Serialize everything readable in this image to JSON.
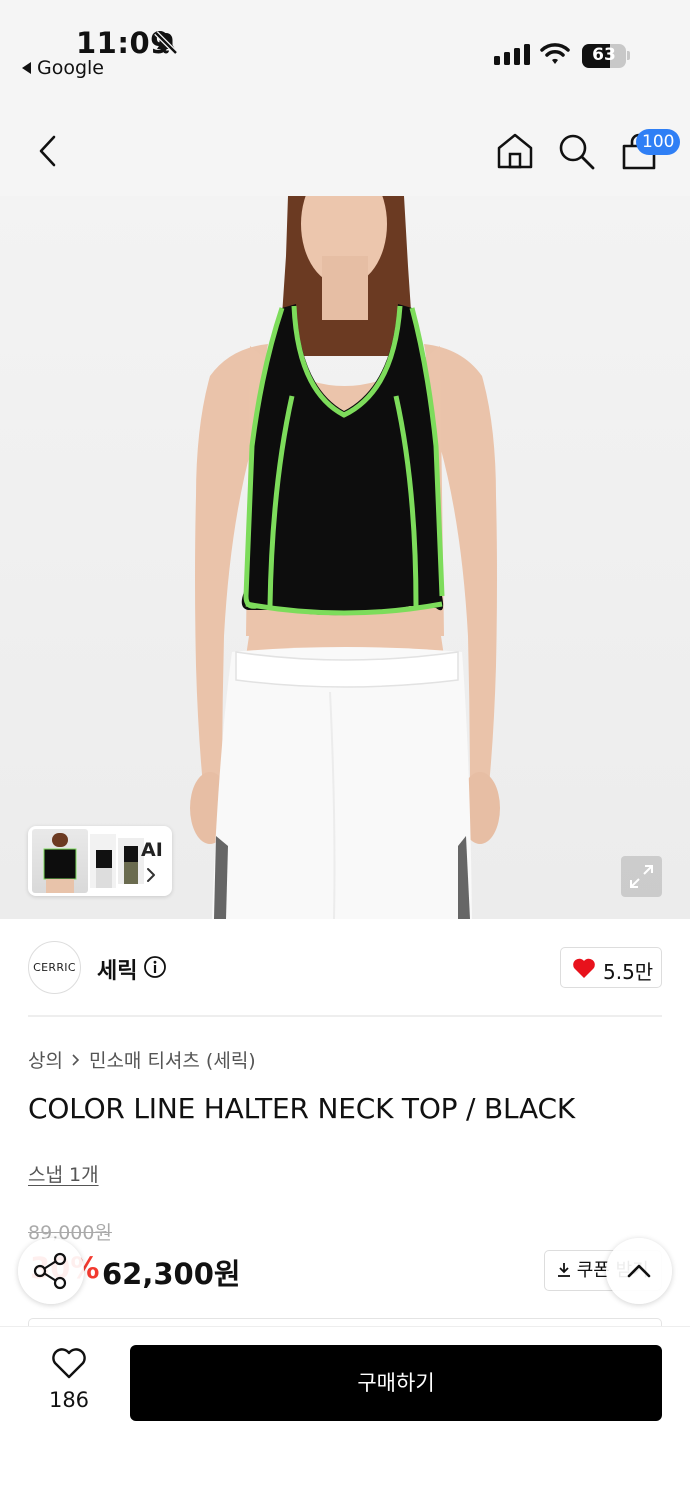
{
  "status_bar": {
    "time": "11:09",
    "back_app": "Google",
    "battery": "63",
    "battery_level": 0.63
  },
  "nav": {
    "cart_count": "100"
  },
  "gallery": {
    "ai_label": "AI"
  },
  "brand": {
    "logo_text": "CERRIC",
    "name": "세릭",
    "like_count": "5.5만"
  },
  "product": {
    "breadcrumb": [
      "상의",
      "민소매 티셔츠 (세릭)"
    ],
    "title": "COLOR LINE HALTER NECK TOP / BLACK",
    "snap": "스냅 1개",
    "original_price": "89,000원",
    "discount": "30%",
    "price": "62,300원",
    "coupon_label": "쿠폰 받기"
  },
  "bottom": {
    "wish_count": "186",
    "buy_label": "구매하기"
  },
  "colors": {
    "accent_blue": "#2f7ff5",
    "discount_red": "#f23a2f",
    "heart_red": "#e8121c",
    "neon_green": "#7ddc5b"
  },
  "icons": [
    "bell-off-icon",
    "signal-icon",
    "wifi-icon",
    "battery-icon",
    "back-icon",
    "home-icon",
    "search-icon",
    "shopping-bag-icon",
    "chevron-right-icon",
    "expand-icon",
    "info-icon",
    "heart-icon",
    "download-icon",
    "share-icon",
    "chevron-up-icon",
    "heart-outline-icon"
  ]
}
